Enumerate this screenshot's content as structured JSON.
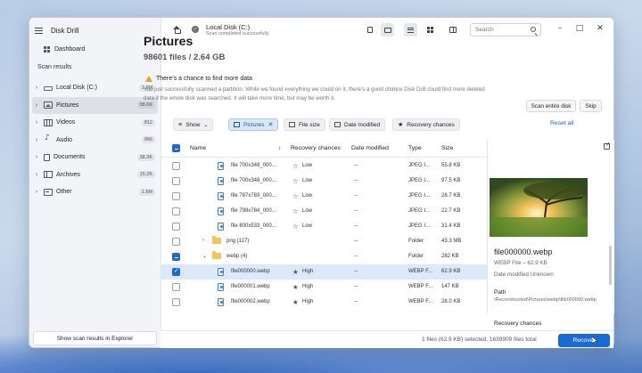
{
  "app": {
    "title": "Disk Drill"
  },
  "sidebar": {
    "dashboard_label": "Dashboard",
    "section_label": "Scan results",
    "items": [
      {
        "label": "Local Disk (C:)",
        "count": "1.6M",
        "icon": "disk-icon"
      },
      {
        "label": "Pictures",
        "count": "98.6K",
        "icon": "picture-icon"
      },
      {
        "label": "Videos",
        "count": "812",
        "icon": "video-icon"
      },
      {
        "label": "Audio",
        "count": "966",
        "icon": "audio-icon"
      },
      {
        "label": "Documents",
        "count": "38.3K",
        "icon": "document-icon"
      },
      {
        "label": "Archives",
        "count": "15.2K",
        "icon": "archive-icon"
      },
      {
        "label": "Other",
        "count": "1.5M",
        "icon": "other-icon"
      }
    ],
    "explorer_button": "Show scan results in Explorer"
  },
  "topbar": {
    "location_title": "Local Disk (C:)",
    "location_status": "Scan completed successfully",
    "search_placeholder": "Search"
  },
  "header": {
    "title": "Pictures",
    "subtitle": "98601 files / 2.64 GB"
  },
  "banner": {
    "title": "There's a chance to find more data",
    "text": "You just successfully scanned a partition. While we found everything we could on it, there's a good chance Disk Drill could find more deleted data if the whole disk was searched. It will take more time, but may be worth it.",
    "scan_button": "Scan entire disk",
    "skip_button": "Skip"
  },
  "filters": {
    "show": "Show",
    "pictures": "Pictures",
    "file_size": "File size",
    "date_modified": "Date modified",
    "recovery_chances": "Recovery chances",
    "reset": "Reset all"
  },
  "table": {
    "columns": {
      "name": "Name",
      "recovery": "Recovery chances",
      "date": "Date modified",
      "type": "Type",
      "size": "Size"
    },
    "rows": [
      {
        "kind": "file",
        "name": "file 700x348_000...",
        "recovery": "Low",
        "date": "--",
        "type": "JPEG I...",
        "size": "55.8 KB",
        "checked": false
      },
      {
        "kind": "file",
        "name": "file 700x348_000...",
        "recovery": "Low",
        "date": "--",
        "type": "JPEG I...",
        "size": "97.5 KB",
        "checked": false
      },
      {
        "kind": "file",
        "name": "file 787x783_000...",
        "recovery": "Low",
        "date": "--",
        "type": "JPEG I...",
        "size": "28.7 KB",
        "checked": false
      },
      {
        "kind": "file",
        "name": "file 798x784_000...",
        "recovery": "Low",
        "date": "--",
        "type": "JPEG I...",
        "size": "22.7 KB",
        "checked": false
      },
      {
        "kind": "file",
        "name": "file 800x533_000...",
        "recovery": "Low",
        "date": "--",
        "type": "JPEG I...",
        "size": "31.4 KB",
        "checked": false
      },
      {
        "kind": "folder",
        "name": "png (117)",
        "recovery": "",
        "date": "--",
        "type": "Folder",
        "size": "43.3 MB",
        "checked": false
      },
      {
        "kind": "folder-open",
        "name": "webp (4)",
        "recovery": "",
        "date": "--",
        "type": "Folder",
        "size": "282 KB",
        "checked": "partial"
      },
      {
        "kind": "file-sub",
        "name": "file000000.webp",
        "recovery": "High",
        "date": "--",
        "type": "WEBP F...",
        "size": "62.9 KB",
        "checked": true
      },
      {
        "kind": "file-sub",
        "name": "file000001.webp",
        "recovery": "High",
        "date": "--",
        "type": "WEBP F...",
        "size": "147 KB",
        "checked": false
      },
      {
        "kind": "file-sub",
        "name": "file000002.webp",
        "recovery": "High",
        "date": "--",
        "type": "WEBP F...",
        "size": "28.0 KB",
        "checked": false
      }
    ]
  },
  "preview": {
    "name": "file000000.webp",
    "type": "WEBP File – 62.9 KB",
    "date": "Date modified Unknown",
    "path_label": "Path",
    "path": "\\Reconstructed\\Pictures\\webp\\file000000.webp",
    "recovery_label": "Recovery chances"
  },
  "status": {
    "text": "1 files (62.9 KB) selected, 1639909 files total",
    "recover_button": "Recover"
  },
  "colors": {
    "accent": "#1a6ad6",
    "selected_row": "#dbeafb",
    "warning": "#e0a32a"
  }
}
